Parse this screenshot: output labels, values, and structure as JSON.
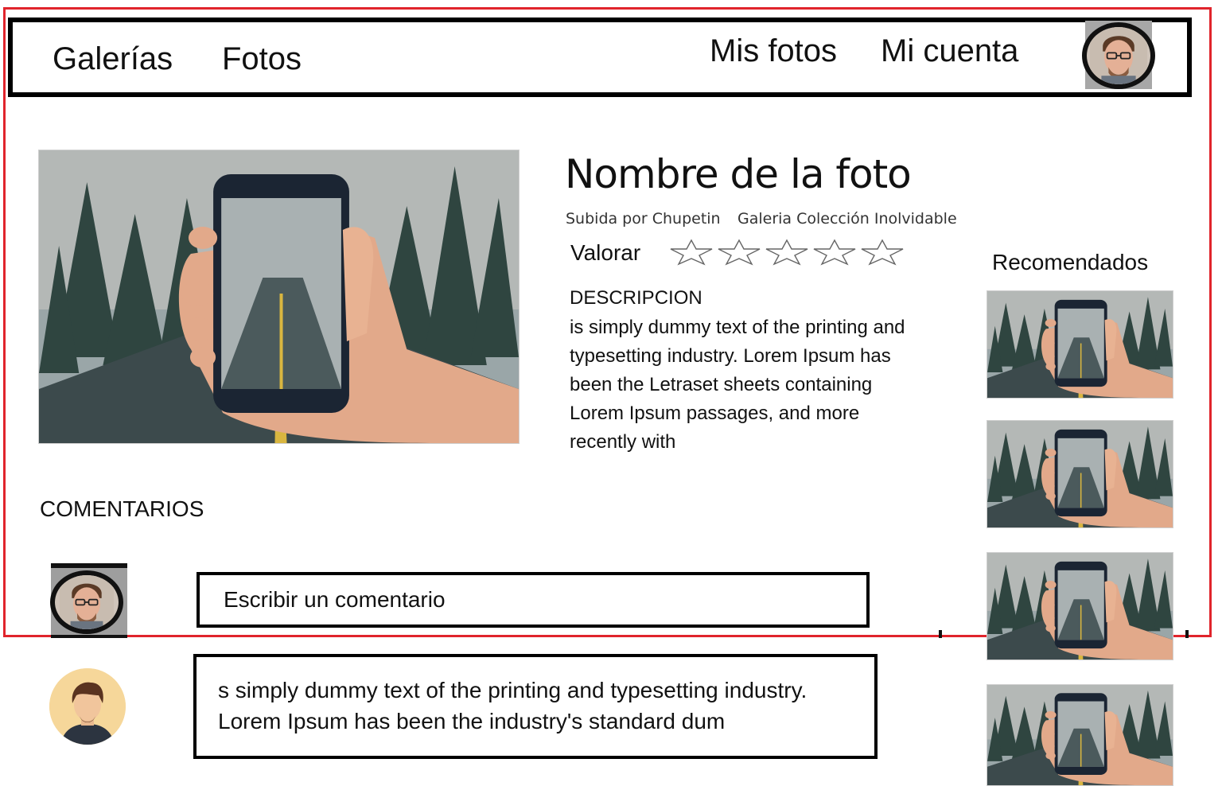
{
  "nav": {
    "left_links": [
      "Galerías",
      "Fotos"
    ],
    "right_links": [
      "Mis fotos",
      "Mi cuenta"
    ],
    "avatar_icon": "user-avatar-icon"
  },
  "photo": {
    "title": "Nombre de la foto",
    "uploaded_by": "Subida por Chupetin",
    "gallery": "Galeria Colección Inolvidable",
    "rate_label": "Valorar",
    "stars_total": 5,
    "stars_filled": 0,
    "description_heading": "DESCRIPCION",
    "description": "is simply dummy text of the printing and typesetting industry. Lorem Ipsum has been the Letraset sheets containing Lorem Ipsum passages, and more recently with"
  },
  "recommended": {
    "title": "Recomendados",
    "count": 4
  },
  "comments": {
    "heading": "COMENTARIOS",
    "input_placeholder": "Escribir un comentario",
    "items": [
      {
        "text": "s simply dummy text of the printing and typesetting industry. Lorem Ipsum has been the industry's standard dum"
      }
    ]
  },
  "colors": {
    "frame_red": "#e0242c",
    "border": "#000000",
    "avatar_bg": "#f6d79a"
  }
}
